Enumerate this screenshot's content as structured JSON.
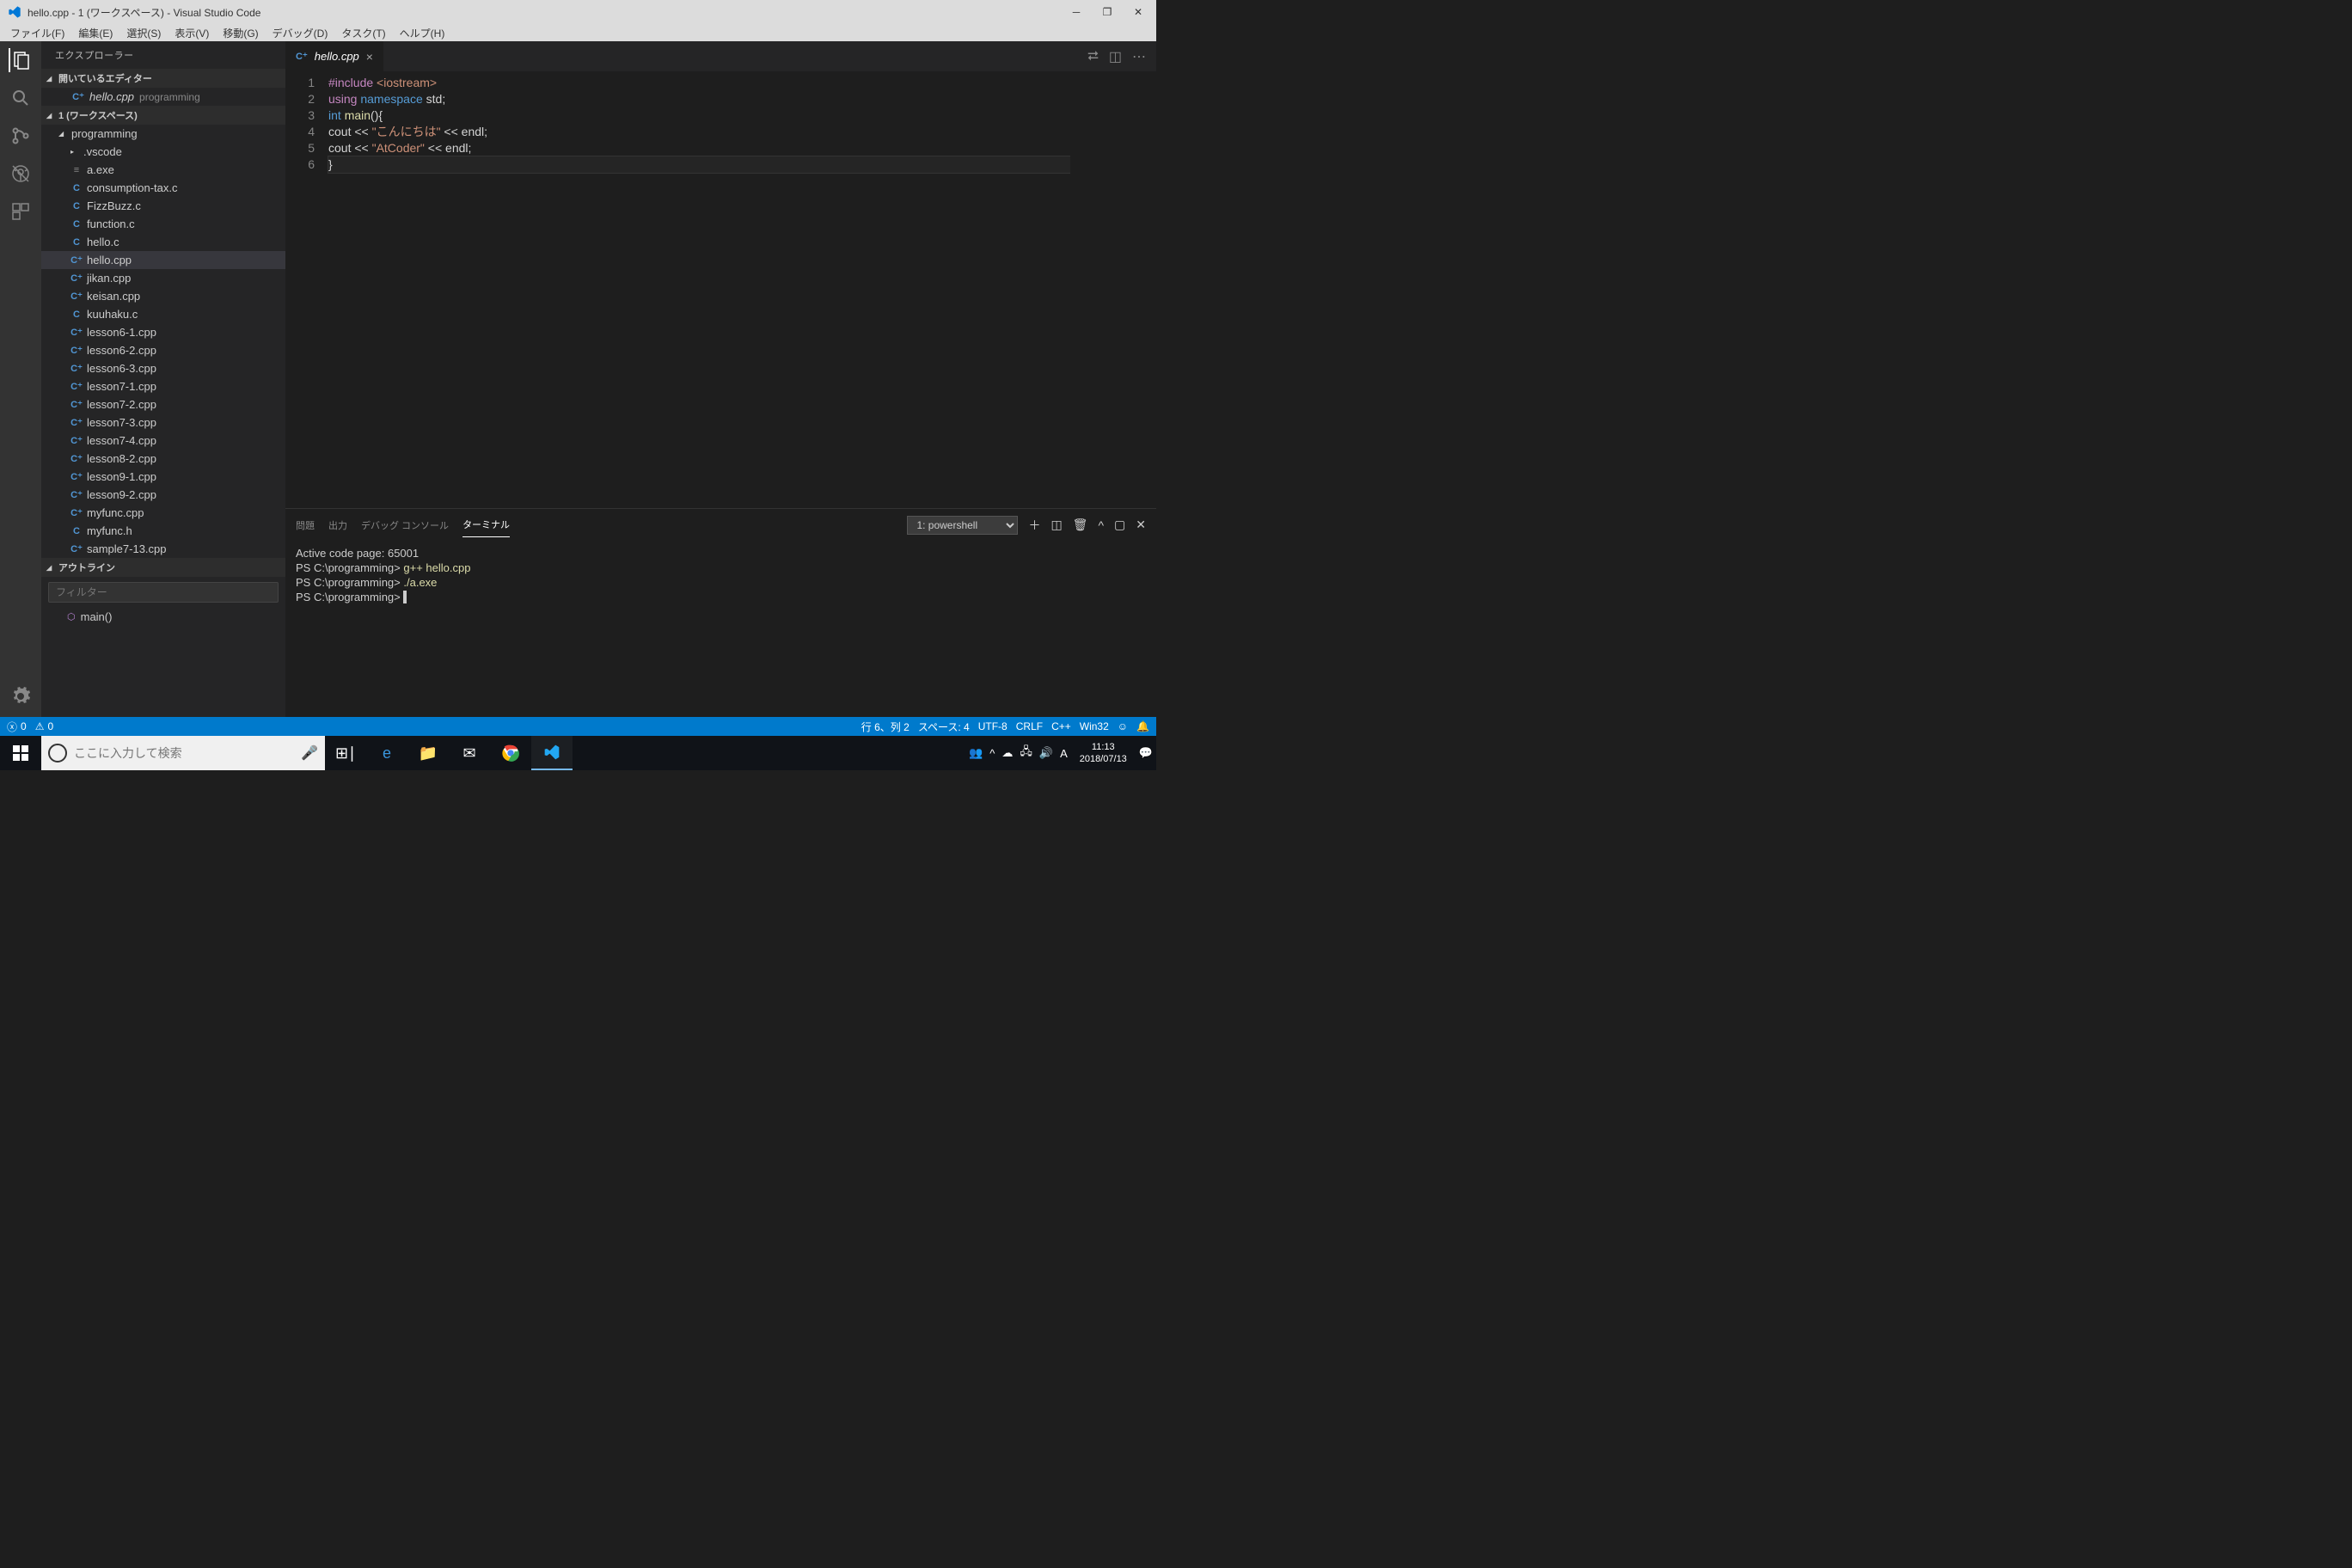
{
  "window": {
    "title": "hello.cpp - 1 (ワークスペース) - Visual Studio Code"
  },
  "menubar": [
    "ファイル(F)",
    "編集(E)",
    "選択(S)",
    "表示(V)",
    "移動(G)",
    "デバッグ(D)",
    "タスク(T)",
    "ヘルプ(H)"
  ],
  "sidebar": {
    "title": "エクスプローラー",
    "openEditorsHeader": "開いているエディター",
    "workspaceHeader": "1 (ワークスペース)",
    "openEditor": {
      "name": "hello.cpp",
      "folder": "programming"
    },
    "folder": "programming",
    "subfolder": ".vscode",
    "files": [
      {
        "name": "a.exe",
        "type": "exe",
        "icon": "≡"
      },
      {
        "name": "consumption-tax.c",
        "type": "c",
        "icon": "C"
      },
      {
        "name": "FizzBuzz.c",
        "type": "c",
        "icon": "C"
      },
      {
        "name": "function.c",
        "type": "c",
        "icon": "C"
      },
      {
        "name": "hello.c",
        "type": "c",
        "icon": "C"
      },
      {
        "name": "hello.cpp",
        "type": "cpp",
        "icon": "C⁺",
        "selected": true
      },
      {
        "name": "jikan.cpp",
        "type": "cpp",
        "icon": "C⁺"
      },
      {
        "name": "keisan.cpp",
        "type": "cpp",
        "icon": "C⁺"
      },
      {
        "name": "kuuhaku.c",
        "type": "c",
        "icon": "C"
      },
      {
        "name": "lesson6-1.cpp",
        "type": "cpp",
        "icon": "C⁺"
      },
      {
        "name": "lesson6-2.cpp",
        "type": "cpp",
        "icon": "C⁺"
      },
      {
        "name": "lesson6-3.cpp",
        "type": "cpp",
        "icon": "C⁺"
      },
      {
        "name": "lesson7-1.cpp",
        "type": "cpp",
        "icon": "C⁺"
      },
      {
        "name": "lesson7-2.cpp",
        "type": "cpp",
        "icon": "C⁺"
      },
      {
        "name": "lesson7-3.cpp",
        "type": "cpp",
        "icon": "C⁺"
      },
      {
        "name": "lesson7-4.cpp",
        "type": "cpp",
        "icon": "C⁺"
      },
      {
        "name": "lesson8-2.cpp",
        "type": "cpp",
        "icon": "C⁺"
      },
      {
        "name": "lesson9-1.cpp",
        "type": "cpp",
        "icon": "C⁺"
      },
      {
        "name": "lesson9-2.cpp",
        "type": "cpp",
        "icon": "C⁺"
      },
      {
        "name": "myfunc.cpp",
        "type": "cpp",
        "icon": "C⁺"
      },
      {
        "name": "myfunc.h",
        "type": "c",
        "icon": "C"
      },
      {
        "name": "sample7-13.cpp",
        "type": "cpp",
        "icon": "C⁺"
      }
    ],
    "outlineHeader": "アウトライン",
    "outlineFilterPlaceholder": "フィルター",
    "outlineItem": "main()"
  },
  "tab": {
    "name": "hello.cpp"
  },
  "code": {
    "lines": [
      "1",
      "2",
      "3",
      "4",
      "5",
      "6"
    ],
    "l1": {
      "a": "#include",
      "b": " <iostream>"
    },
    "l2": {
      "a": "using",
      "b": "namespace",
      "c": " std;"
    },
    "l3": {
      "a": "int",
      "b": "main",
      "c": "(){"
    },
    "l4": {
      "a": "    cout << ",
      "b": "\"こんにちは\"",
      "c": " << endl;"
    },
    "l5": {
      "a": "    cout << ",
      "b": "\"AtCoder\"",
      "c": " << endl;"
    },
    "l6": {
      "a": "}"
    }
  },
  "panel": {
    "tabs": [
      "問題",
      "出力",
      "デバッグ コンソール",
      "ターミナル"
    ],
    "terminalSelect": "1: powershell",
    "terminal": {
      "line1": "Active code page: 65001",
      "prompt": "PS C:\\programming>",
      "cmd1": "g++ hello.cpp",
      "cmd2": "./a.exe"
    }
  },
  "status": {
    "errors": "0",
    "warnings": "0",
    "cursor": "行 6、列 2",
    "spaces": "スペース: 4",
    "encoding": "UTF-8",
    "eol": "CRLF",
    "lang": "C++",
    "platform": "Win32"
  },
  "taskbar": {
    "searchPlaceholder": "ここに入力して検索",
    "time": "11:13",
    "date": "2018/07/13",
    "ime": "A"
  }
}
